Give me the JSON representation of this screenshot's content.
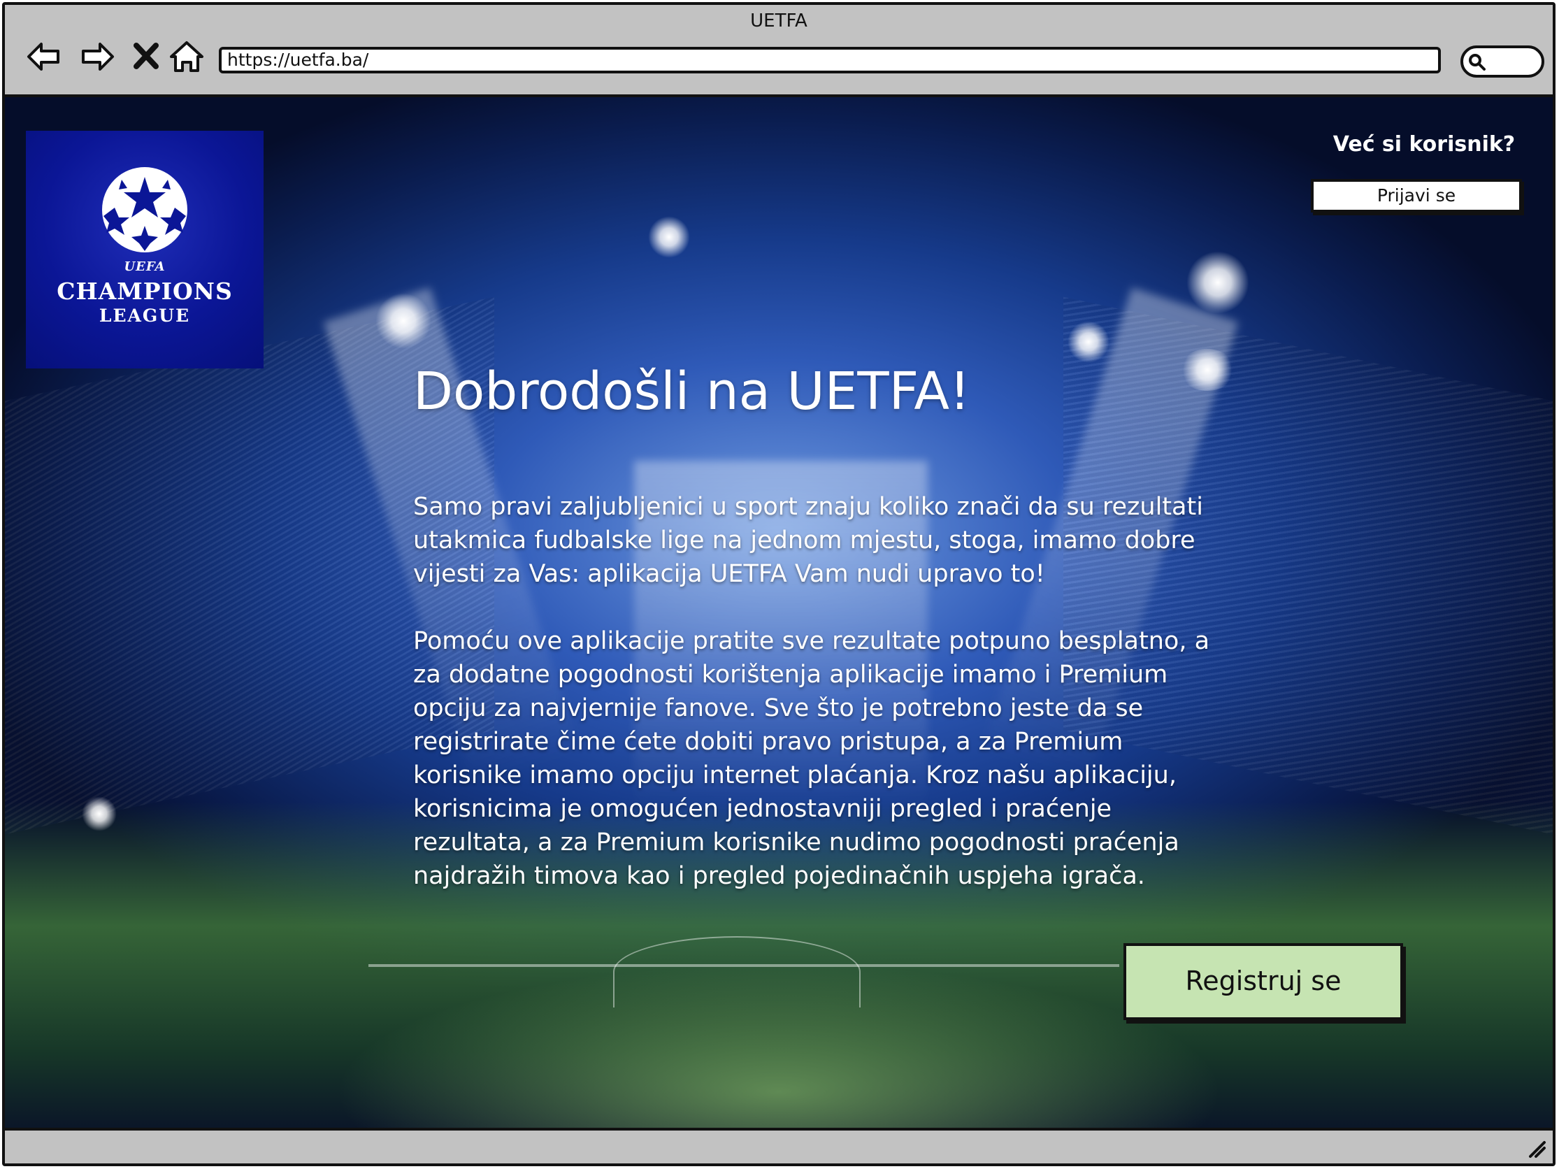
{
  "browser": {
    "title": "UETFA",
    "url": "https://uetfa.ba/",
    "icons": [
      "back-arrow-icon",
      "forward-arrow-icon",
      "stop-icon",
      "home-icon",
      "search-icon",
      "resize-grip-icon"
    ]
  },
  "logo": {
    "small": "UEFA",
    "line1": "CHAMPIONS",
    "line2": "LEAGUE"
  },
  "header": {
    "login_question": "Već si korisnik?",
    "login_button": "Prijavi se"
  },
  "main": {
    "title": "Dobrodošli na UETFA!",
    "paragraph1": "Samo pravi zaljubljenici u sport znaju koliko znači da su rezultati utakmica fudbalske lige na jednom mjestu, stoga, imamo dobre vijesti za Vas: aplikacija UETFA Vam nudi upravo to!",
    "paragraph2": "Pomoću ove aplikacije pratite sve rezultate potpuno besplatno, a za dodatne pogodnosti korištenja aplikacije imamo i Premium opciju za najvjernije fanove. Sve što je potrebno jeste da se registrirate čime ćete dobiti pravo pristupa, a za Premium korisnike imamo opciju internet plaćanja. Kroz našu aplikaciju, korisnicima je omogućen jednostavniji pregled i praćenje rezultata, a za Premium korisnike nudimo pogodnosti praćenja najdražih timova kao i pregled pojedinačnih uspjeha igrača.",
    "register_button": "Registruj se"
  },
  "colors": {
    "register_button_bg": "#c6e4b2",
    "logo_bg": "#0b1696",
    "chrome_bg": "#c2c2c2"
  }
}
